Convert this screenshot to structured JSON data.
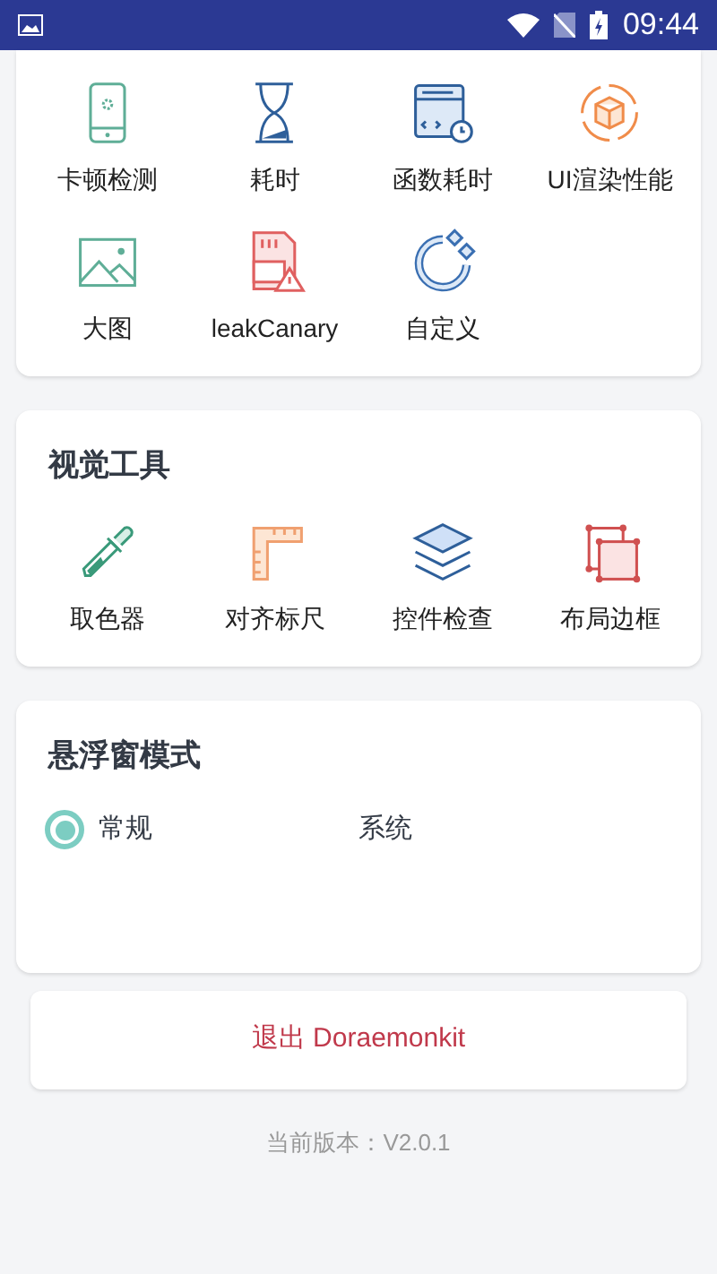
{
  "status_bar": {
    "time": "09:44"
  },
  "performance_tools": [
    {
      "label": "卡顿检测"
    },
    {
      "label": "耗时"
    },
    {
      "label": "函数耗时"
    },
    {
      "label": "UI渲染性能"
    },
    {
      "label": "大图"
    },
    {
      "label": "leakCanary"
    },
    {
      "label": "自定义"
    }
  ],
  "visual_tools": {
    "title": "视觉工具",
    "items": [
      {
        "label": "取色器"
      },
      {
        "label": "对齐标尺"
      },
      {
        "label": "控件检查"
      },
      {
        "label": "布局边框"
      }
    ]
  },
  "float_mode": {
    "title": "悬浮窗模式",
    "options": [
      {
        "label": "常规",
        "selected": true
      },
      {
        "label": "系统",
        "selected": false
      }
    ]
  },
  "exit_button": "退出 Doraemonkit",
  "version": "当前版本：V2.0.1"
}
